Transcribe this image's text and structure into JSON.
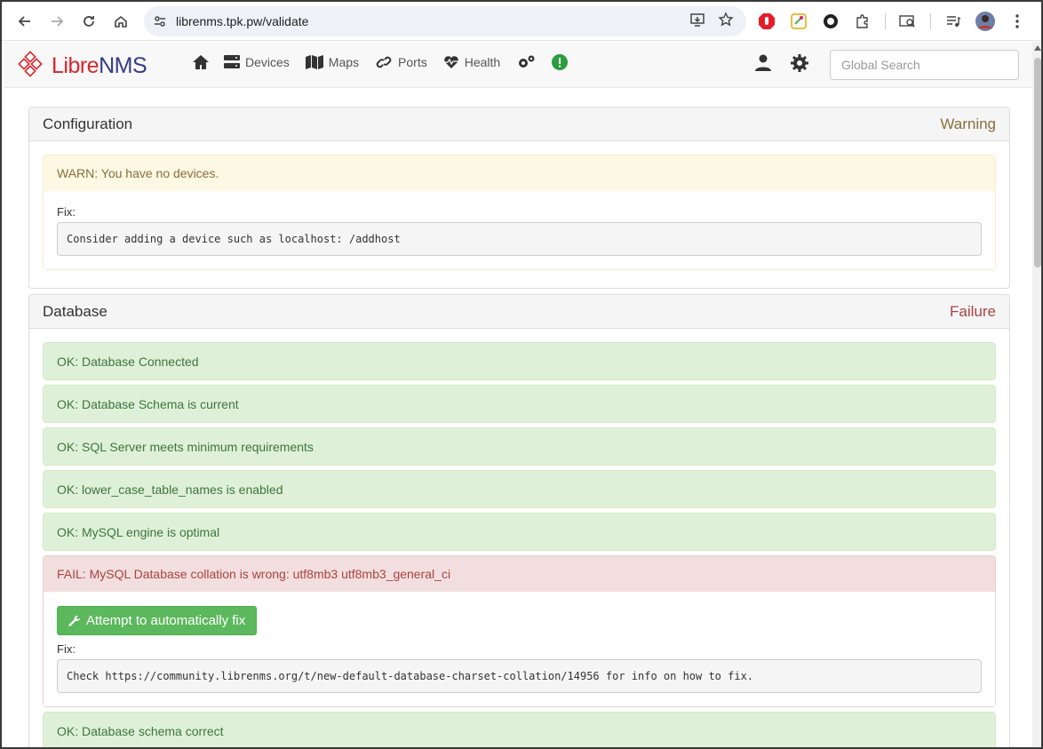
{
  "browser": {
    "url": "librenms.tpk.pw/validate"
  },
  "app": {
    "brand_libre": "Libre",
    "brand_nms": "NMS",
    "menu": [
      {
        "label": "Devices",
        "icon": "server-icon"
      },
      {
        "label": "Maps",
        "icon": "map-icon"
      },
      {
        "label": "Ports",
        "icon": "link-icon"
      },
      {
        "label": "Health",
        "icon": "heartbeat-icon"
      }
    ],
    "search_placeholder": "Global Search",
    "colors": {
      "ok_bg": "#dff0d8",
      "warn_bg": "#fcf8e3",
      "fail_bg": "#f2dede",
      "button_green": "#5cb85c"
    }
  },
  "configuration": {
    "title": "Configuration",
    "status": "Warning",
    "warn_message": "WARN: You have no devices.",
    "fix_label": "Fix:",
    "fix_text": "Consider adding a device such as localhost: /addhost"
  },
  "database": {
    "title": "Database",
    "status": "Failure",
    "ok_items": [
      "OK: Database Connected",
      "OK: Database Schema is current",
      "OK: SQL Server meets minimum requirements",
      "OK: lower_case_table_names is enabled",
      "OK: MySQL engine is optimal"
    ],
    "fail_message": "FAIL: MySQL Database collation is wrong: utf8mb3 utf8mb3_general_ci",
    "fix_button": "Attempt to automatically fix",
    "fix_label": "Fix:",
    "fix_text": "Check https://community.librenms.org/t/new-default-database-charset-collation/14956 for info on how to fix.",
    "ok_after": "OK: Database schema correct"
  }
}
